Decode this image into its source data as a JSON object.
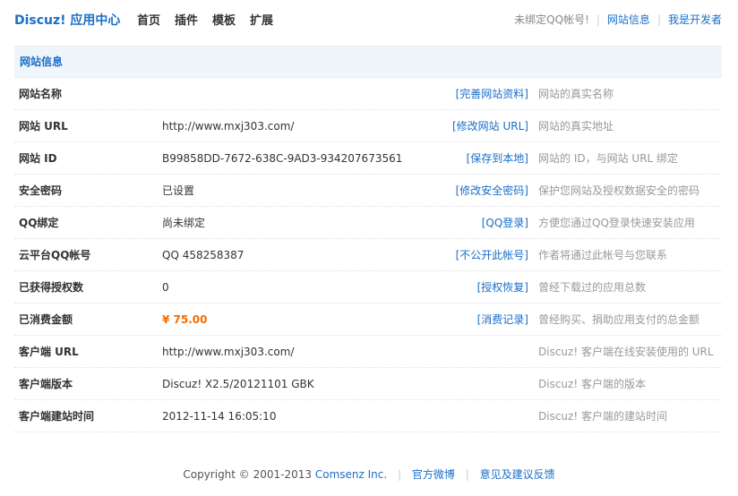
{
  "header": {
    "logo": "Discuz! 应用中心",
    "nav": [
      "首页",
      "插件",
      "模板",
      "扩展"
    ],
    "qq_status": "未绑定QQ帐号!",
    "site_info_link": "网站信息",
    "developer_link": "我是开发者"
  },
  "panel": {
    "title": "网站信息",
    "rows": [
      {
        "label": "网站名称",
        "value": "",
        "action": "[完善网站资料]",
        "desc": "网站的真实名称"
      },
      {
        "label": "网站 URL",
        "value": "http://www.mxj303.com/",
        "action": "[修改网站 URL]",
        "desc": "网站的真实地址"
      },
      {
        "label": "网站 ID",
        "value": "B99858DD-7672-638C-9AD3-934207673561",
        "action": "[保存到本地]",
        "desc": "网站的 ID，与网站 URL 绑定"
      },
      {
        "label": "安全密码",
        "value": "已设置",
        "action": "[修改安全密码]",
        "desc": "保护您网站及授权数据安全的密码"
      },
      {
        "label": "QQ绑定",
        "value": "尚未绑定",
        "action": "[QQ登录]",
        "desc": "方便您通过QQ登录快速安装应用"
      },
      {
        "label": "云平台QQ帐号",
        "value": "QQ 458258387",
        "action": "[不公开此帐号]",
        "desc": "作者将通过此帐号与您联系"
      },
      {
        "label": "已获得授权数",
        "value": "0",
        "action": "[授权恢复]",
        "desc": "曾经下载过的应用总数"
      },
      {
        "label": "已消费金额",
        "value": "¥ 75.00",
        "action": "[消费记录]",
        "desc": "曾经购买、捐助应用支付的总金额"
      },
      {
        "label": "客户端 URL",
        "value": "http://www.mxj303.com/",
        "action": "",
        "desc": "Discuz! 客户端在线安装使用的 URL"
      },
      {
        "label": "客户端版本",
        "value": "Discuz! X2.5/20121101 GBK",
        "action": "",
        "desc": "Discuz! 客户端的版本"
      },
      {
        "label": "客户端建站时间",
        "value": "2012-11-14 16:05:10",
        "action": "",
        "desc": "Discuz! 客户端的建站时间"
      }
    ]
  },
  "footer": {
    "copyright": "Copyright © 2001-2013",
    "company": "Comsenz Inc.",
    "weibo": "官方微博",
    "feedback": "意见及建议反馈"
  },
  "colors": {
    "accent": "#1a6ec8",
    "price": "#f26c00",
    "panel_head_bg": "#eef6fc"
  }
}
